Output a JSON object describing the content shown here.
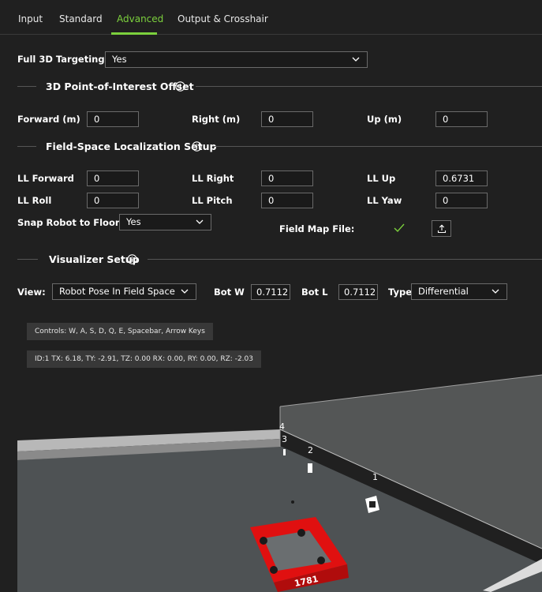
{
  "tabs": [
    {
      "label": "Input"
    },
    {
      "label": "Standard"
    },
    {
      "label": "Advanced",
      "active": true
    },
    {
      "label": "Output & Crosshair"
    }
  ],
  "full3d": {
    "label": "Full 3D Targeting",
    "value": "Yes"
  },
  "poi": {
    "title": "3D Point-of-Interest Offset",
    "forward": {
      "label": "Forward (m)",
      "value": "0"
    },
    "right": {
      "label": "Right (m)",
      "value": "0"
    },
    "up": {
      "label": "Up (m)",
      "value": "0"
    }
  },
  "localization": {
    "title": "Field-Space Localization Setup",
    "ll_forward": {
      "label": "LL Forward",
      "value": "0"
    },
    "ll_right": {
      "label": "LL Right",
      "value": "0"
    },
    "ll_up": {
      "label": "LL Up",
      "value": "0.6731"
    },
    "ll_roll": {
      "label": "LL Roll",
      "value": "0"
    },
    "ll_pitch": {
      "label": "LL Pitch",
      "value": "0"
    },
    "ll_yaw": {
      "label": "LL Yaw",
      "value": "0"
    },
    "snap": {
      "label": "Snap Robot to Floor",
      "value": "Yes"
    },
    "field_map": {
      "label": "Field Map File:"
    }
  },
  "visualizer": {
    "title": "Visualizer Setup",
    "view": {
      "label": "View:",
      "value": "Robot Pose In Field Space"
    },
    "bot_w": {
      "label": "Bot W",
      "value": "0.7112"
    },
    "bot_l": {
      "label": "Bot L",
      "value": "0.7112"
    },
    "type": {
      "label": "Type",
      "value": "Differential"
    },
    "controls": "Controls: W, A, S, D, Q, E, Spacebar, Arrow Keys",
    "pose": "ID:1 TX: 6.18, TY: -2.91, TZ: 0.00 RX: 0.00, RY: 0.00, RZ: -2.03",
    "tag_labels": [
      "4",
      "3",
      "2",
      "1"
    ],
    "robot_number": "1781"
  },
  "icons": {
    "info": "info-icon",
    "chevron": "chevron-down-icon",
    "check": "checkmark-icon",
    "upload": "upload-icon"
  },
  "colors": {
    "accent": "#7cd13d",
    "background": "#202020",
    "robot": "#e01010"
  }
}
